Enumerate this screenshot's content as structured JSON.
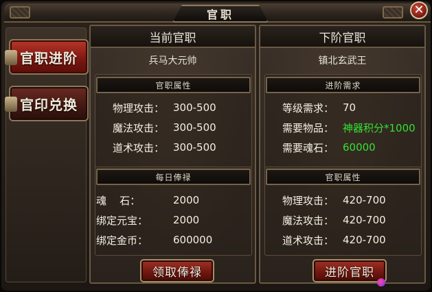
{
  "window": {
    "title": "官职",
    "close_glyph": "✕"
  },
  "sidebar": {
    "items": [
      {
        "label": "官职进阶",
        "active": true
      },
      {
        "label": "官印兑换",
        "active": false
      }
    ]
  },
  "current": {
    "header": "当前官职",
    "rank_name": "兵马大元帅",
    "attr_section": "官职属性",
    "attributes": [
      {
        "label": "物理攻击：",
        "value": "300-500"
      },
      {
        "label": "魔法攻击：",
        "value": "300-500"
      },
      {
        "label": "道术攻击：",
        "value": "300-500"
      }
    ],
    "salary_section": "每日俸禄",
    "salary": [
      {
        "label": "魂    石：",
        "value": "2000"
      },
      {
        "label": "绑定元宝：",
        "value": "2000"
      },
      {
        "label": "绑定金币：",
        "value": "600000"
      }
    ],
    "button": "领取俸禄"
  },
  "next": {
    "header": "下阶官职",
    "rank_name": "镇北玄武王",
    "req_section": "进阶需求",
    "requirements": [
      {
        "label": "等级需求：",
        "value": "70",
        "highlight": false
      },
      {
        "label": "需要物品：",
        "value": "神器积分*1000",
        "highlight": true
      },
      {
        "label": "需要魂石：",
        "value": "60000",
        "highlight": true
      }
    ],
    "attr_section": "官职属性",
    "attributes": [
      {
        "label": "物理攻击：",
        "value": "420-700"
      },
      {
        "label": "魔法攻击：",
        "value": "420-700"
      },
      {
        "label": "道术攻击：",
        "value": "420-700"
      }
    ],
    "button": "进阶官职"
  },
  "colors": {
    "highlight_green": "#34e034",
    "button_red": "#a03228",
    "frame_gold": "#a88d62"
  }
}
